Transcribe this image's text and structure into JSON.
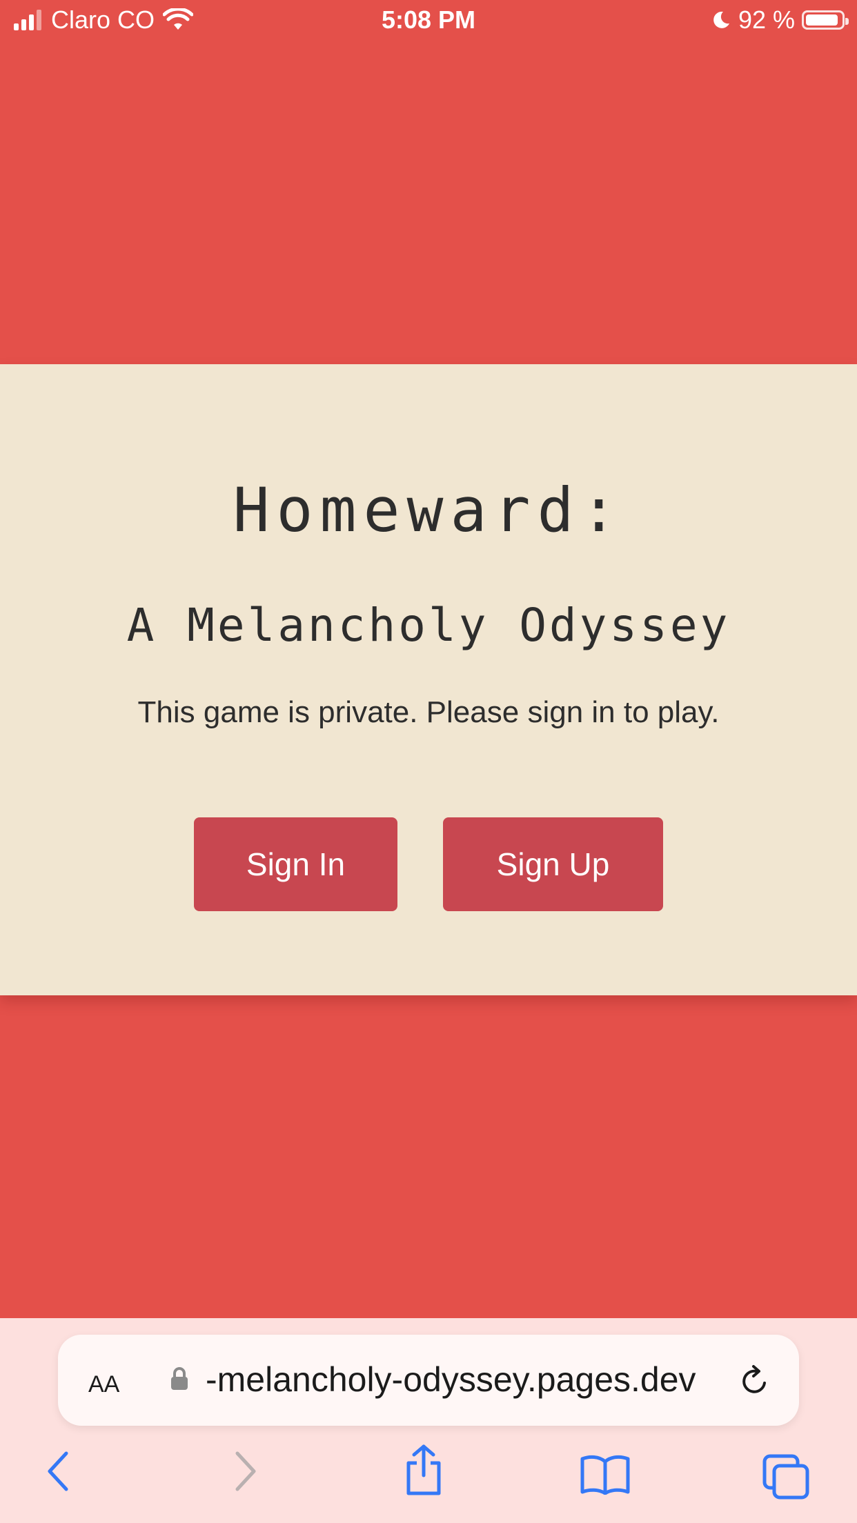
{
  "status_bar": {
    "carrier": "Claro CO",
    "time": "5:08 PM",
    "battery_percent": "92 %",
    "battery_level": 0.92
  },
  "game": {
    "title": "Homeward:",
    "subtitle": "A Melancholy Odyssey",
    "message": "This game is private. Please sign in to play.",
    "sign_in_label": "Sign In",
    "sign_up_label": "Sign Up"
  },
  "browser": {
    "text_size_label": "AA",
    "url": "-melancholy-odyssey.pages.dev",
    "icons": [
      "signal-icon",
      "wifi-icon",
      "moon-icon",
      "battery-icon",
      "lock-icon",
      "reload-icon",
      "back-icon",
      "forward-icon",
      "share-icon",
      "bookmarks-icon",
      "tabs-icon"
    ]
  },
  "colors": {
    "background": "#e4504a",
    "card": "#f1e6d1",
    "button": "#c84750",
    "browser_bar": "#fde0de",
    "accent_blue": "#3478f6"
  }
}
